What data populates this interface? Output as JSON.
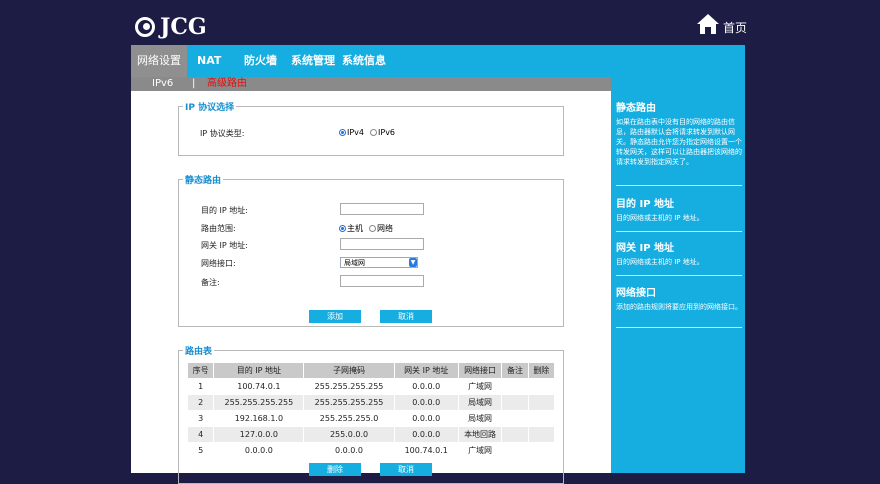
{
  "header": {
    "brand": "JCG",
    "home_label": "首页"
  },
  "nav": {
    "items": [
      {
        "label": "网络设置",
        "active": true
      },
      {
        "label": "NAT"
      },
      {
        "label": "防火墙"
      },
      {
        "label": "系统管理"
      },
      {
        "label": "系统信息"
      }
    ]
  },
  "subnav": {
    "items": [
      {
        "label": "IPv6"
      },
      {
        "label": "|"
      },
      {
        "label": "高级路由",
        "current": true
      }
    ]
  },
  "ip_protocol": {
    "legend": "IP 协议选择",
    "label": "IP 协议类型:",
    "options": [
      {
        "label": "IPv4",
        "checked": true
      },
      {
        "label": "IPv6",
        "checked": false
      }
    ]
  },
  "static_route": {
    "legend": "静态路由",
    "fields": {
      "dest_ip": {
        "label": "目的 IP 地址:",
        "value": ""
      },
      "route_scope": {
        "label": "路由范围:",
        "options": [
          {
            "label": "主机",
            "checked": true
          },
          {
            "label": "网络",
            "checked": false
          }
        ]
      },
      "gateway_ip": {
        "label": "网关 IP 地址:",
        "value": ""
      },
      "interface": {
        "label": "网络接口:",
        "selected": "局域网"
      },
      "remark": {
        "label": "备注:",
        "value": ""
      }
    },
    "add_button": "添加",
    "cancel_button": "取消"
  },
  "route_table": {
    "legend": "路由表",
    "columns": [
      "序号",
      "目的 IP 地址",
      "子网掩码",
      "网关 IP 地址",
      "网络接口",
      "备注",
      "删除"
    ],
    "rows": [
      [
        "1",
        "100.74.0.1",
        "255.255.255.255",
        "0.0.0.0",
        "广域网",
        "",
        ""
      ],
      [
        "2",
        "255.255.255.255",
        "255.255.255.255",
        "0.0.0.0",
        "局域网",
        "",
        ""
      ],
      [
        "3",
        "192.168.1.0",
        "255.255.255.0",
        "0.0.0.0",
        "局域网",
        "",
        ""
      ],
      [
        "4",
        "127.0.0.0",
        "255.0.0.0",
        "0.0.0.0",
        "本地回路",
        "",
        ""
      ],
      [
        "5",
        "0.0.0.0",
        "0.0.0.0",
        "100.74.0.1",
        "广域网",
        "",
        ""
      ]
    ],
    "delete_button": "删除",
    "cancel_button": "取消"
  },
  "help": [
    {
      "title": "静态路由",
      "text": "如果在路由表中没有目的网络的路由信息，路由器默认会将请求转发到默认网关。静态路由允许您为指定网络设置一个转发网关，这样可以让路由器把该网络的请求转发到指定网关了。"
    },
    {
      "title": "目的 IP 地址",
      "text": "目的网络或主机的 IP 地址。"
    },
    {
      "title": "网关 IP 地址",
      "text": "目的网络或主机的 IP 地址。"
    },
    {
      "title": "网络接口",
      "text": "添加的路由规则将要应用到的网络接口。"
    }
  ]
}
